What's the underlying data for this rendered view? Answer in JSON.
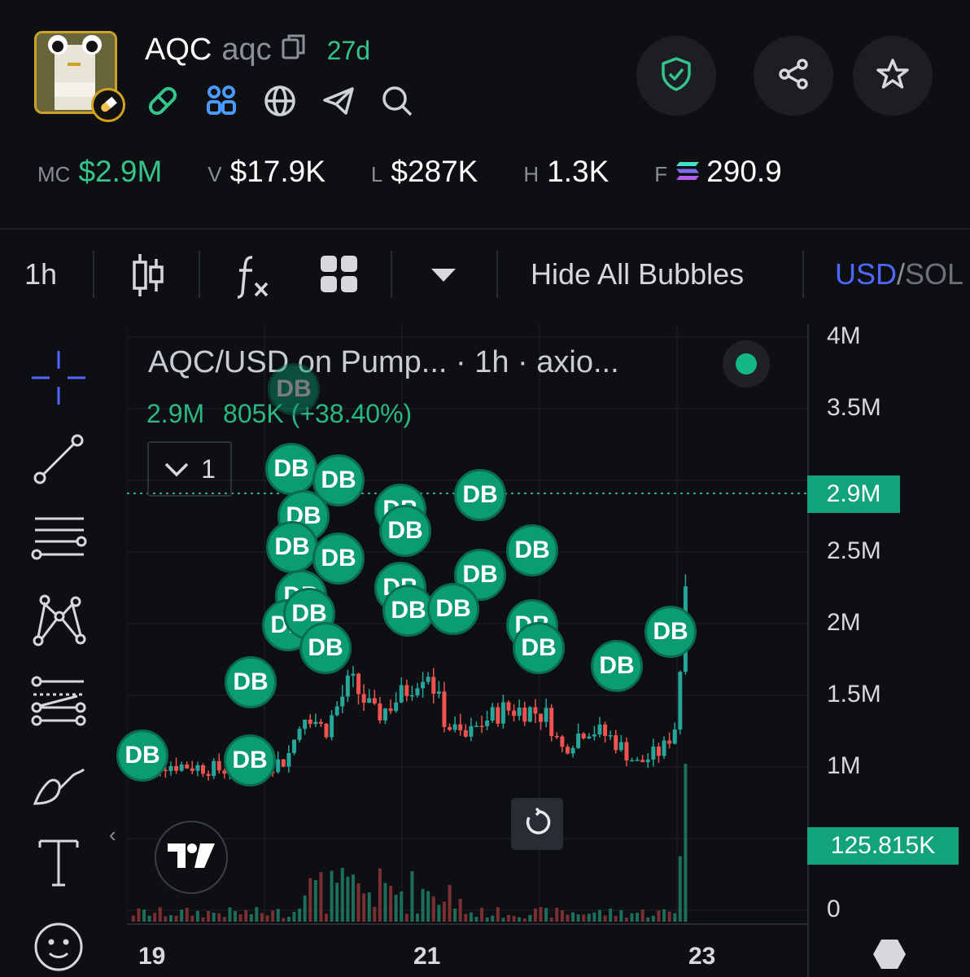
{
  "token": {
    "name": "AQC",
    "ticker": "aqc",
    "age": "27d"
  },
  "stats": [
    {
      "label": "MC",
      "value": "$2.9M",
      "color": "#35c48a"
    },
    {
      "label": "V",
      "value": "$17.9K",
      "color": "#ffffff"
    },
    {
      "label": "L",
      "value": "$287K",
      "color": "#ffffff"
    },
    {
      "label": "H",
      "value": "1.3K",
      "color": "#ffffff"
    },
    {
      "label": "F",
      "value": "290.9",
      "color": "#ffffff"
    }
  ],
  "toolbar": {
    "interval": "1h",
    "hide_bubbles": "Hide All Bubbles",
    "currency_active": "USD",
    "currency_sep": "/",
    "currency_other": "SOL"
  },
  "chart": {
    "legend_title": "AQC/USD on Pump... · 1h · axio...",
    "legend_price": "2.9M",
    "legend_change": "805K (+38.40%)",
    "collapse_count": "1",
    "bubble_label": "DB",
    "price_tag": "2.9M",
    "volume_tag": "125.815K",
    "y_ticks": [
      "4M",
      "3.5M",
      "2.9M",
      "2.5M",
      "2M",
      "1.5M",
      "1M",
      "0"
    ],
    "x_ticks": [
      "19",
      "21",
      "23"
    ],
    "up_color": "#26a69a",
    "down_color": "#ef5350",
    "accent": "#4f67ff"
  },
  "chart_data": {
    "type": "candlestick",
    "title": "AQC/USD on Pump... · 1h · axio...",
    "x_ticks": [
      "19",
      "21",
      "23"
    ],
    "ylim": [
      0,
      4000000
    ],
    "last_price": 2900000,
    "change": "805K (+38.40%)",
    "series": [
      {
        "name": "AQC/USD",
        "close_trend": [
          [
            18.6,
            1030000
          ],
          [
            19.0,
            1010000
          ],
          [
            19.3,
            980000
          ],
          [
            19.6,
            1000000
          ],
          [
            19.8,
            1050000
          ],
          [
            19.95,
            1400000
          ],
          [
            20.1,
            1250000
          ],
          [
            20.3,
            1600000
          ],
          [
            20.5,
            1350000
          ],
          [
            20.7,
            1500000
          ],
          [
            20.9,
            1700000
          ],
          [
            21.05,
            1300000
          ],
          [
            21.2,
            1200000
          ],
          [
            21.35,
            1320000
          ],
          [
            21.5,
            1400000
          ],
          [
            21.7,
            1400000
          ],
          [
            21.85,
            1350000
          ],
          [
            21.95,
            1120000
          ],
          [
            22.15,
            1280000
          ],
          [
            22.35,
            1200000
          ],
          [
            22.55,
            1020000
          ],
          [
            22.75,
            1120000
          ],
          [
            22.85,
            1300000
          ],
          [
            22.92,
            2100000
          ],
          [
            22.95,
            2900000
          ]
        ]
      }
    ]
  }
}
